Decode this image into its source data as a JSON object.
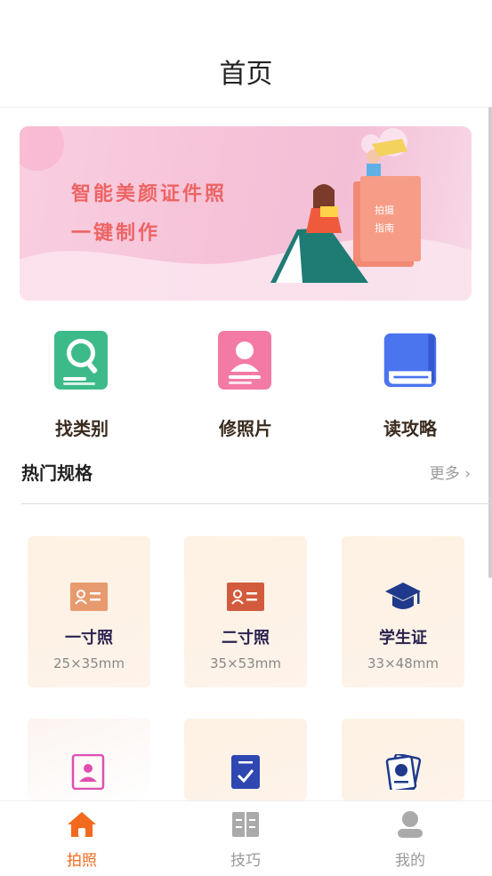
{
  "header": {
    "title": "首页"
  },
  "banner": {
    "line1": "智能美颜证件照",
    "line2": "一键制作",
    "book_text": [
      "拍摄",
      "指南"
    ]
  },
  "quick_actions": [
    {
      "label": "找类别",
      "icon": "search-document-icon",
      "color": "#3dba8a"
    },
    {
      "label": "修照片",
      "icon": "portrait-edit-icon",
      "color": "#f27aa5"
    },
    {
      "label": "读攻略",
      "icon": "guide-book-icon",
      "color": "#4b74ef"
    }
  ],
  "section": {
    "title": "热门规格",
    "more_label": "更多"
  },
  "specs": [
    {
      "name": "一寸照",
      "size": "25×35mm",
      "icon": "id-card-icon"
    },
    {
      "name": "二寸照",
      "size": "35×53mm",
      "icon": "id-card-icon"
    },
    {
      "name": "学生证",
      "size": "33×48mm",
      "icon": "graduation-cap-icon"
    },
    {
      "name": "",
      "size": "",
      "icon": "portrait-frame-icon"
    },
    {
      "name": "",
      "size": "",
      "icon": "checklist-icon"
    },
    {
      "name": "",
      "size": "",
      "icon": "passport-icon"
    }
  ],
  "tabbar": {
    "active": "拍照",
    "items": [
      {
        "label": "拍照",
        "icon": "home-icon"
      },
      {
        "label": "技巧",
        "icon": "book-open-icon"
      },
      {
        "label": "我的",
        "icon": "user-icon"
      }
    ]
  },
  "colors": {
    "accent": "#f26a1e",
    "banner_text": "#ec6464",
    "card_bg": "#fdf2e3"
  }
}
